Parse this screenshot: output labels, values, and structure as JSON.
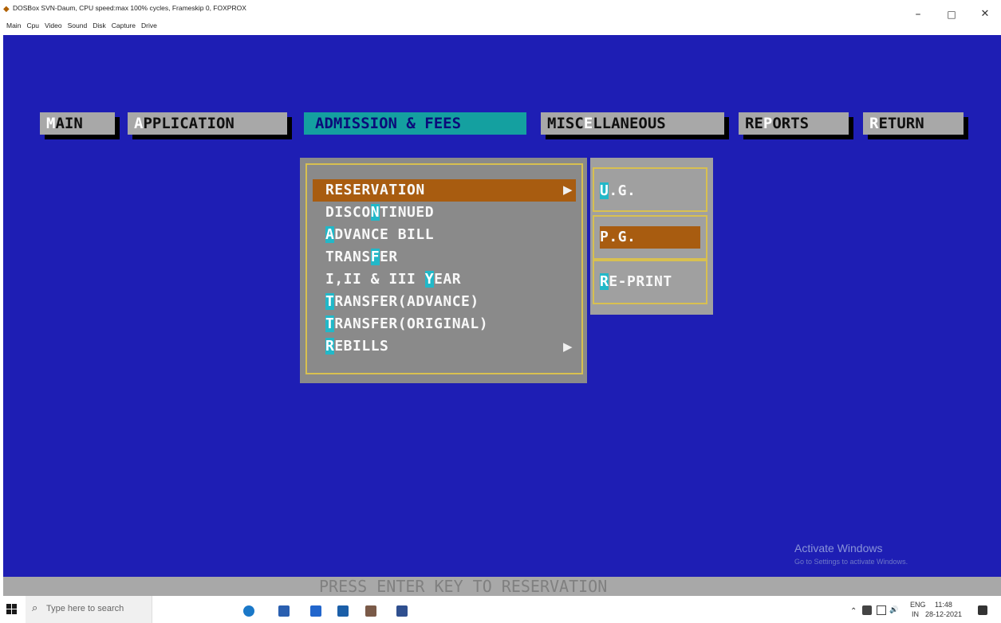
{
  "window": {
    "title": "DOSBox SVN-Daum, CPU speed:max 100% cycles, Frameskip 0, FOXPROX",
    "menu": [
      "Main",
      "Cpu",
      "Video",
      "Sound",
      "Disk",
      "Capture",
      "Drive"
    ],
    "controls": {
      "minimize": "–",
      "maximize": "□",
      "close": "✕"
    }
  },
  "topmenu": [
    {
      "hk": "M",
      "rest": "AIN"
    },
    {
      "hk": "A",
      "rest": "PPLICATION"
    },
    {
      "hk": "",
      "rest": "ADMISSION & FEES"
    },
    {
      "pre": "MISC",
      "hk": "E",
      "rest": "LLANEOUS"
    },
    {
      "pre": "RE",
      "hk": "P",
      "rest": "ORTS"
    },
    {
      "hk": "R",
      "rest": "ETURN"
    }
  ],
  "dropdown": [
    {
      "pre": "RESERVATION",
      "hk": "",
      "rest": ""
    },
    {
      "pre": "DISCO",
      "hk": "N",
      "rest": "TINUED"
    },
    {
      "pre": "",
      "hk": "A",
      "rest": "DVANCE BILL"
    },
    {
      "pre": "TRANS",
      "hk": "F",
      "rest": "ER"
    },
    {
      "pre": "I,II & III ",
      "hk": "Y",
      "rest": "EAR"
    },
    {
      "pre": "",
      "hk": "T",
      "rest": "RANSFER(ADVANCE)"
    },
    {
      "pre": "",
      "hk": "T",
      "rest": "RANSFER(ORIGINAL)"
    },
    {
      "pre": "",
      "hk": "R",
      "rest": "EBILLS"
    }
  ],
  "submenu": [
    {
      "hk": "U",
      "rest": ".G."
    },
    {
      "hk": "",
      "rest": "P.G."
    },
    {
      "hk": "R",
      "rest": "E-PRINT"
    }
  ],
  "arrow": "▶",
  "status": "PRESS ENTER KEY TO RESERVATION",
  "watermark": {
    "title": "Activate Windows",
    "sub": "Go to Settings to activate Windows."
  },
  "taskbar": {
    "search_placeholder": "Type here to search",
    "search_icon": "search-icon",
    "lang_top": "ENG",
    "lang_bottom": "IN",
    "time": "11:48",
    "date": "28-12-2021"
  }
}
